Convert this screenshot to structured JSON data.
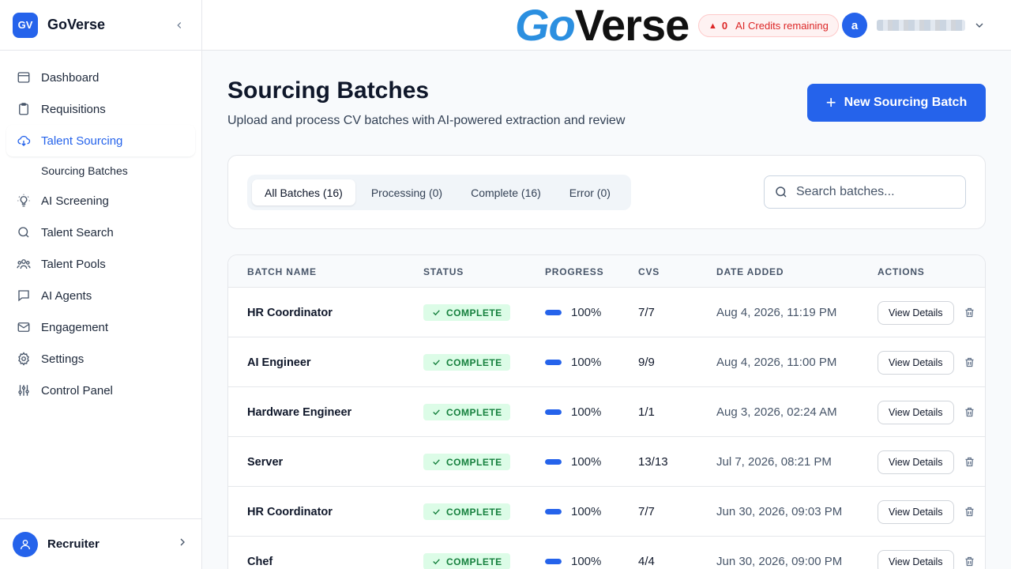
{
  "sidebar": {
    "logo_initials": "GV",
    "brand": "GoVerse",
    "items": [
      {
        "label": "Dashboard",
        "icon": "dashboard-icon"
      },
      {
        "label": "Requisitions",
        "icon": "clipboard-icon"
      },
      {
        "label": "Talent Sourcing",
        "icon": "cloud-download-icon",
        "active": true
      },
      {
        "label": "Sourcing Batches",
        "sub": true
      },
      {
        "label": "AI Screening",
        "icon": "lightbulb-icon"
      },
      {
        "label": "Talent Search",
        "icon": "search-icon"
      },
      {
        "label": "Talent Pools",
        "icon": "users-icon"
      },
      {
        "label": "AI Agents",
        "icon": "chat-icon"
      },
      {
        "label": "Engagement",
        "icon": "mail-icon"
      },
      {
        "label": "Settings",
        "icon": "gear-icon"
      },
      {
        "label": "Control Panel",
        "icon": "sliders-icon"
      }
    ],
    "footer_user": "Recruiter"
  },
  "topbar": {
    "logo_part1": "Go",
    "logo_part2": "Verse",
    "credits_count": "0",
    "credits_label": "AI Credits remaining",
    "user_initial": "a"
  },
  "page": {
    "title": "Sourcing Batches",
    "subtitle": "Upload and process CV batches with AI-powered extraction and review",
    "new_button": "New Sourcing Batch"
  },
  "filters": {
    "tabs": [
      "All Batches (16)",
      "Processing (0)",
      "Complete (16)",
      "Error (0)"
    ],
    "search_placeholder": "Search batches..."
  },
  "table": {
    "headers": [
      "BATCH NAME",
      "STATUS",
      "PROGRESS",
      "CVS",
      "DATE ADDED",
      "ACTIONS"
    ],
    "rows": [
      {
        "name": "HR Coordinator",
        "status": "COMPLETE",
        "progress": "100%",
        "progress_value": 1.0,
        "cvs": "7/7",
        "date": "Aug 4, 2026, 11:19 PM",
        "action": "View Details"
      },
      {
        "name": "AI Engineer",
        "status": "COMPLETE",
        "progress": "100%",
        "progress_value": 1.0,
        "cvs": "9/9",
        "date": "Aug 4, 2026, 11:00 PM",
        "action": "View Details"
      },
      {
        "name": "Hardware Engineer",
        "status": "COMPLETE",
        "progress": "100%",
        "progress_value": 1.0,
        "cvs": "1/1",
        "date": "Aug 3, 2026, 02:24 AM",
        "action": "View Details"
      },
      {
        "name": "Server",
        "status": "COMPLETE",
        "progress": "100%",
        "progress_value": 1.0,
        "cvs": "13/13",
        "date": "Jul 7, 2026, 08:21 PM",
        "action": "View Details"
      },
      {
        "name": "HR Coordinator",
        "status": "COMPLETE",
        "progress": "100%",
        "progress_value": 1.0,
        "cvs": "7/7",
        "date": "Jun 30, 2026, 09:03 PM",
        "action": "View Details"
      },
      {
        "name": "Chef",
        "status": "COMPLETE",
        "progress": "100%",
        "progress_value": 1.0,
        "cvs": "4/4",
        "date": "Jun 30, 2026, 09:00 PM",
        "action": "View Details"
      }
    ]
  },
  "colors": {
    "accent": "#2563eb",
    "complete_bg": "#dcfce7",
    "complete_text": "#15803d",
    "credits_text": "#dc2626"
  }
}
